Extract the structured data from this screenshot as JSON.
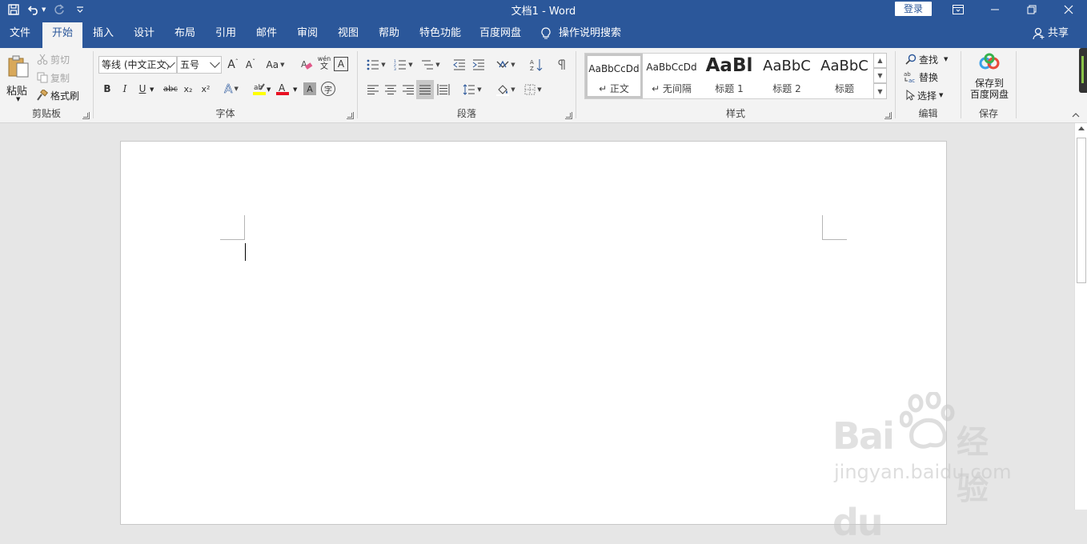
{
  "app": {
    "window_title": "文档1  -  Word",
    "login_label": "登录",
    "share_label": "共享",
    "colors": {
      "brand": "#2b579a",
      "ribbon_bg": "#f3f3f3",
      "font_color_bar": "#e81123",
      "highlight_bar": "#ffff00"
    }
  },
  "qat": {
    "save_icon": "save-icon",
    "undo_icon": "undo-icon",
    "redo_icon": "redo-icon",
    "customize_icon": "customize-qat-icon"
  },
  "tabs": [
    {
      "label": "文件"
    },
    {
      "label": "开始",
      "active": true
    },
    {
      "label": "插入"
    },
    {
      "label": "设计"
    },
    {
      "label": "布局"
    },
    {
      "label": "引用"
    },
    {
      "label": "邮件"
    },
    {
      "label": "审阅"
    },
    {
      "label": "视图"
    },
    {
      "label": "帮助"
    },
    {
      "label": "特色功能"
    },
    {
      "label": "百度网盘"
    }
  ],
  "tell_me": "操作说明搜索",
  "ribbon": {
    "clipboard": {
      "label": "剪贴板",
      "paste": "粘贴",
      "cut": "剪切",
      "copy": "复制",
      "format_painter": "格式刷"
    },
    "font": {
      "label": "字体",
      "font_name": "等线 (中文正文)",
      "font_size": "五号",
      "change_case": "Aa",
      "phonetic_top": "wén",
      "phonetic_bottom": "文",
      "border_char": "A",
      "bold": "B",
      "italic": "I",
      "underline": "U",
      "strike": "abc",
      "subscript": "x₂",
      "superscript": "x²",
      "text_effect": "A",
      "font_color": "A",
      "char_shading": "A",
      "enclose_char": "字"
    },
    "paragraph": {
      "label": "段落"
    },
    "styles": {
      "label": "样式",
      "items": [
        {
          "sample": "AaBbCcDd",
          "name": "↵ 正文"
        },
        {
          "sample": "AaBbCcDd",
          "name": "↵ 无间隔"
        },
        {
          "sample": "AaBl",
          "name": "标题 1"
        },
        {
          "sample": "AaBbC",
          "name": "标题 2"
        },
        {
          "sample": "AaBbC",
          "name": "标题"
        }
      ]
    },
    "editing": {
      "label": "编辑",
      "find": "查找",
      "replace": "替换",
      "select": "选择"
    },
    "save": {
      "label": "保存",
      "save_to_line1": "保存到",
      "save_to_line2": "百度网盘"
    }
  },
  "watermark": {
    "logo": "Bai",
    "logo_tail": "du",
    "cn": "经验",
    "url": "jingyan.baidu.com"
  }
}
